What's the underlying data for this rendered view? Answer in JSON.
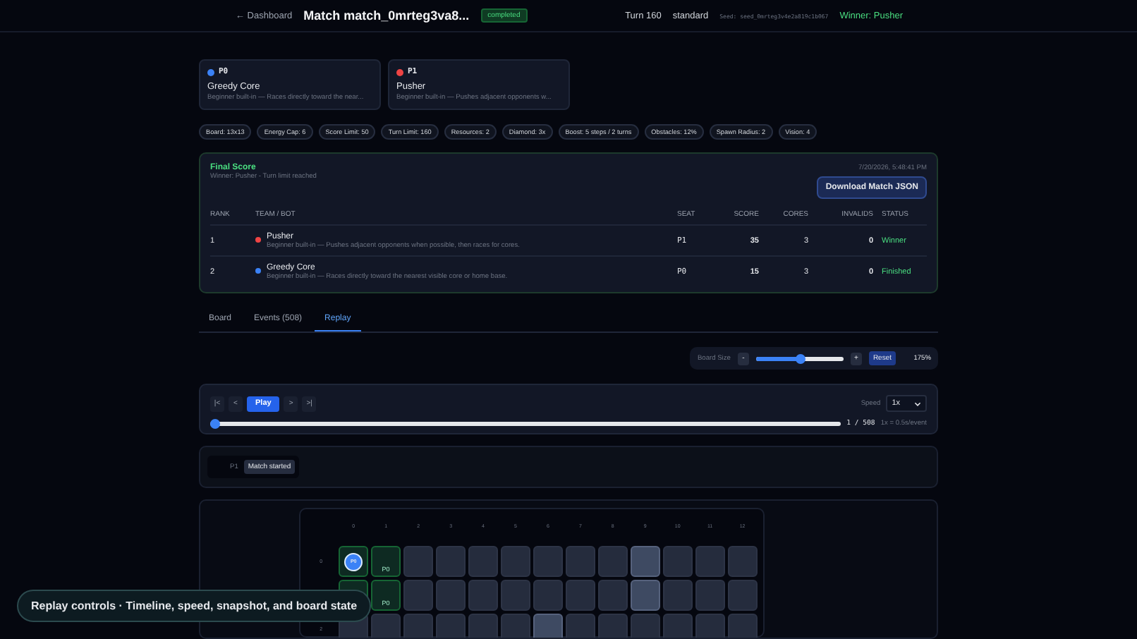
{
  "header": {
    "back_link": "← Dashboard",
    "title": "Match match_0mrteg3va8...",
    "status_badge": "completed",
    "turn": "Turn 160",
    "mode": "standard",
    "seed": "Seed: seed_0mrteg3v4e2a819c1b067",
    "winner": "Winner: Pusher"
  },
  "players": [
    {
      "seat": "P0",
      "color": "#3b82f6",
      "name": "Greedy Core",
      "description": "Beginner built-in — Races directly toward the near..."
    },
    {
      "seat": "P1",
      "color": "#ef4444",
      "name": "Pusher",
      "description": "Beginner built-in — Pushes adjacent opponents w..."
    }
  ],
  "settings": [
    "Board: 13x13",
    "Energy Cap: 6",
    "Score Limit: 50",
    "Turn Limit: 160",
    "Resources: 2",
    "Diamond: 3x",
    "Boost: 5 steps / 2 turns",
    "Obstacles: 12%",
    "Spawn Radius: 2",
    "Vision: 4"
  ],
  "final_score": {
    "title": "Final Score",
    "subtitle": "Winner: Pusher - Turn limit reached",
    "timestamp": "7/20/2026, 5:48:41 PM",
    "download_button": "Download Match JSON",
    "columns": [
      "RANK",
      "TEAM / BOT",
      "SEAT",
      "SCORE",
      "CORES",
      "INVALIDS",
      "STATUS"
    ],
    "rows": [
      {
        "rank": "1",
        "color": "#ef4444",
        "name": "Pusher",
        "description": "Beginner built-in — Pushes adjacent opponents when possible, then races for cores.",
        "seat": "P1",
        "score": "35",
        "cores": "3",
        "invalids": "0",
        "status": "Winner"
      },
      {
        "rank": "2",
        "color": "#3b82f6",
        "name": "Greedy Core",
        "description": "Beginner built-in — Races directly toward the nearest visible core or home base.",
        "seat": "P0",
        "score": "15",
        "cores": "3",
        "invalids": "0",
        "status": "Finished"
      }
    ]
  },
  "tabs": [
    {
      "label": "Board",
      "selected": false
    },
    {
      "label": "Events (508)",
      "selected": false
    },
    {
      "label": "Replay",
      "selected": true
    }
  ],
  "board_size": {
    "label": "Board Size",
    "minus": "-",
    "plus": "+",
    "level": 0.5,
    "reset": "Reset",
    "reading": "175%"
  },
  "replay": {
    "buttons": [
      "|<",
      "<",
      "Play",
      ">",
      ">|"
    ],
    "speed_label": "Speed",
    "speed": "1x",
    "level": 0,
    "position": "1 / 508",
    "rate": "1x = 0.5s/event"
  },
  "event": {
    "seat": "P1",
    "text": "Match started"
  },
  "board": {
    "columns": [
      "0",
      "1",
      "2",
      "3",
      "4",
      "5",
      "6",
      "7",
      "8",
      "9",
      "10",
      "11",
      "12"
    ],
    "rows": [
      {
        "label": "0",
        "cells": [
          {
            "kind": "home",
            "token": "P0"
          },
          {
            "kind": "home",
            "mark": "P0"
          },
          {
            "kind": "empty"
          },
          {
            "kind": "empty"
          },
          {
            "kind": "empty"
          },
          {
            "kind": "empty"
          },
          {
            "kind": "empty"
          },
          {
            "kind": "empty"
          },
          {
            "kind": "empty"
          },
          {
            "kind": "obstacle"
          },
          {
            "kind": "empty"
          },
          {
            "kind": "empty"
          },
          {
            "kind": "empty"
          }
        ]
      },
      {
        "cells": [
          {
            "kind": "home"
          },
          {
            "kind": "home",
            "mark": "P0"
          },
          {
            "kind": "empty"
          },
          {
            "kind": "empty"
          },
          {
            "kind": "empty"
          },
          {
            "kind": "empty"
          },
          {
            "kind": "empty"
          },
          {
            "kind": "empty"
          },
          {
            "kind": "empty"
          },
          {
            "kind": "obstacle"
          },
          {
            "kind": "empty"
          },
          {
            "kind": "empty"
          },
          {
            "kind": "empty"
          }
        ]
      },
      {
        "label": "2",
        "cells": [
          {
            "kind": "empty"
          },
          {
            "kind": "empty"
          },
          {
            "kind": "empty"
          },
          {
            "kind": "empty"
          },
          {
            "kind": "empty"
          },
          {
            "kind": "empty"
          },
          {
            "kind": "obstacle"
          },
          {
            "kind": "empty"
          },
          {
            "kind": "empty"
          },
          {
            "kind": "empty"
          },
          {
            "kind": "empty"
          },
          {
            "kind": "empty"
          },
          {
            "kind": "empty"
          }
        ]
      }
    ]
  },
  "tooltip": "Replay controls · Timeline, speed, snapshot, and board state"
}
